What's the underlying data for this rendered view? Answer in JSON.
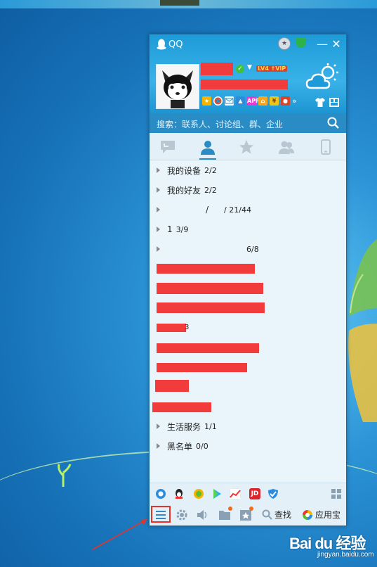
{
  "window": {
    "title": "QQ",
    "minimize_glyph": "—",
    "close_glyph": "✕",
    "medal_icon": "medal-icon",
    "security_icon": "security-shield-icon"
  },
  "profile": {
    "level_badge": "LV4 ↑VIP",
    "status_glyph": "✓",
    "more_apps_glyph": "»",
    "weather_icon": "weather-cloud-sun-icon"
  },
  "search": {
    "placeholder": "搜索：联系人、讨论组、群、企业"
  },
  "tabs": [
    {
      "name": "messages",
      "icon": "chat-icon"
    },
    {
      "name": "contacts",
      "icon": "contact-icon",
      "active": true
    },
    {
      "name": "favorites",
      "icon": "star-icon"
    },
    {
      "name": "groups",
      "icon": "group-icon"
    },
    {
      "name": "devices",
      "icon": "phone-icon"
    }
  ],
  "groups": [
    {
      "label": "我的设备",
      "count": "2/2"
    },
    {
      "label": "我的好友",
      "count": "2/2"
    },
    {
      "label": "/",
      "count": "/ 21/44"
    },
    {
      "label": "1",
      "count": "3/9"
    },
    {
      "label": "",
      "count": "6/8"
    },
    {
      "label": "生活服务",
      "count": "1/1"
    },
    {
      "label": "黑名单",
      "count": "0/0"
    }
  ],
  "redacted_row_fragments": {
    "row4": "3"
  },
  "toolbar": {
    "find_label": "查找",
    "app_store_label": "应用宝",
    "jd_label": "JD"
  },
  "watermark": {
    "brand": "Bai du 经验",
    "url": "jingyan.baidu.com"
  },
  "colors": {
    "qq_blue": "#1d9bd8",
    "highlight_red": "#e5332a",
    "redaction": "#f23b3b"
  }
}
